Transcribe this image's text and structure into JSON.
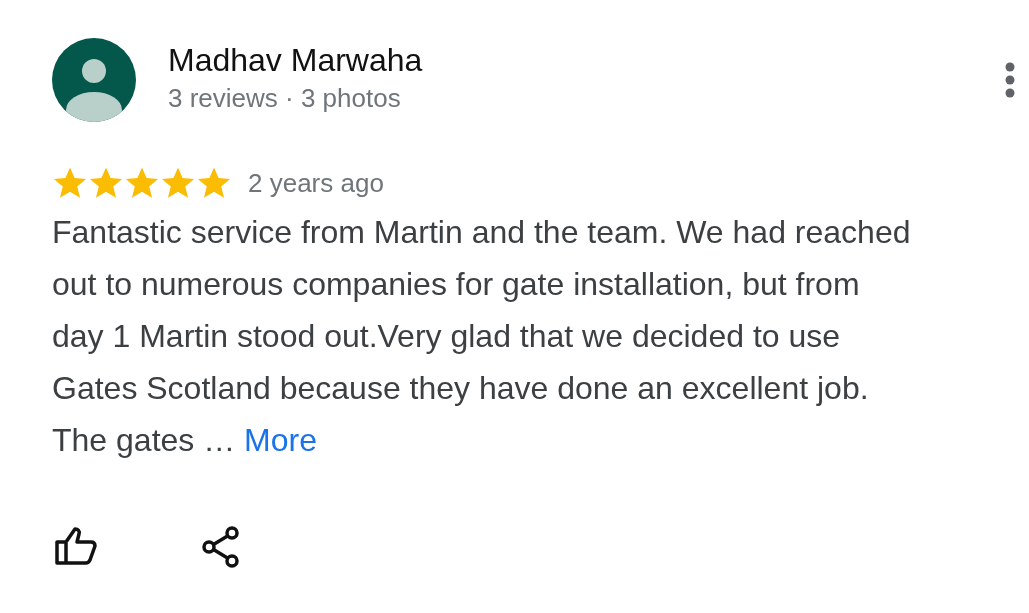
{
  "reviewer": {
    "name": "Madhav Marwaha",
    "meta": "3 reviews · 3 photos"
  },
  "review": {
    "stars": 5,
    "time": "2 years ago",
    "text": "Fantastic service from Martin and the team. We had reached out to numerous companies for gate installation, but from day 1 Martin stood out.Very glad that we decided to use Gates Scotland because they have done an excellent job. The gates …",
    "more": "More"
  }
}
